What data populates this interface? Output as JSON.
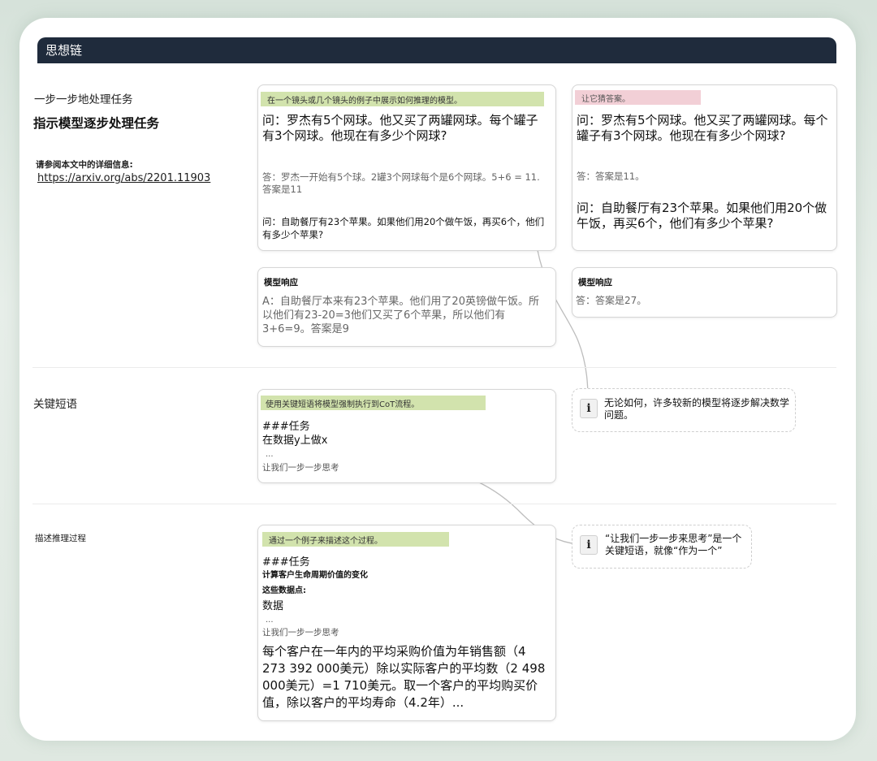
{
  "header": {
    "title": "思想链"
  },
  "section1": {
    "label": "一步一步地处理任务",
    "title": "指示模型逐步处理任务",
    "ref_label": "请参阅本文中的详细信息:",
    "ref_link": "https://arxiv.org/abs/2201.11903",
    "box_left": {
      "highlight": "在一个镜头或几个镜头的例子中展示如何推理的模型。",
      "q1": "问：罗杰有5个网球。他又买了两罐网球。每个罐子有3个网球。他现在有多少个网球?",
      "a1": "答：罗杰一开始有5个球。2罐3个网球每个是6个网球。5+6 = 11. 答案是11",
      "q2": "问：自助餐厅有23个苹果。如果他们用20个做午饭，再买6个，他们有多少个苹果?"
    },
    "box_right": {
      "highlight": "让它猜答案。",
      "q1": "问：罗杰有5个网球。他又买了两罐网球。每个罐子有3个网球。他现在有多少个网球?",
      "a1": "答：答案是11。",
      "q2": "问：自助餐厅有23个苹果。如果他们用20个做午饭，再买6个，他们有多少个苹果?"
    },
    "resp_left": {
      "label": "模型响应",
      "text": "A：自助餐厅本来有23个苹果。他们用了20英镑做午饭。所以他们有23-20=3他们又买了6个苹果，所以他们有3+6=9。答案是9"
    },
    "resp_right": {
      "label": "模型响应",
      "text": "答：答案是27。"
    },
    "info": "无论如何，许多较新的模型将逐步解决数学问题。"
  },
  "section2": {
    "label": "关键短语",
    "highlight": "使用关键短语将模型强制执行到CoT流程。",
    "task": "###任务",
    "do": "在数据y上做x",
    "dots": "...",
    "think": "让我们一步一步思考",
    "info": "“让我们一步一步来思考”是一个关键短语，就像“作为一个”"
  },
  "section3": {
    "label": "描述推理过程",
    "highlight": "通过一个例子来描述这个过程。",
    "task": "###任务",
    "subtitle": "计算客户生命周期价值的变化",
    "points": "这些数据点:",
    "data": "数据",
    "dots": "...",
    "think": "让我们一步一步思考",
    "result": "每个客户在一年内的平均采购价值为年销售额（4 273 392 000美元）除以实际客户的平均数（2 498 000美元）=1 710美元。取一个客户的平均购买价值，除以客户的平均寿命（4.2年）..."
  },
  "icons": {
    "info": "i"
  }
}
